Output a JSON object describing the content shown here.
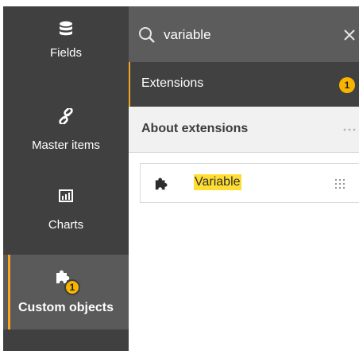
{
  "sidebar": {
    "items": [
      {
        "label": "Fields",
        "icon": "database-icon"
      },
      {
        "label": "Master items",
        "icon": "link-icon"
      },
      {
        "label": "Charts",
        "icon": "bar-chart-icon"
      },
      {
        "label": "Custom objects",
        "icon": "puzzle-icon",
        "badge": "1",
        "active": true
      }
    ]
  },
  "search": {
    "value": "variable",
    "icon": "search-icon",
    "clear_icon": "close-icon"
  },
  "extensions": {
    "label": "Extensions",
    "badge": "1"
  },
  "about": {
    "label": "About extensions",
    "menu_icon": "more-horizontal-icon"
  },
  "results": [
    {
      "label": "Variable",
      "icon": "puzzle-icon",
      "handle_icon": "drag-handle-icon"
    }
  ],
  "colors": {
    "accent": "#f7a521",
    "badge": "#f7b500",
    "highlight": "#ffdd33",
    "rail": "#404040",
    "search_bar": "#5c5c5c"
  }
}
